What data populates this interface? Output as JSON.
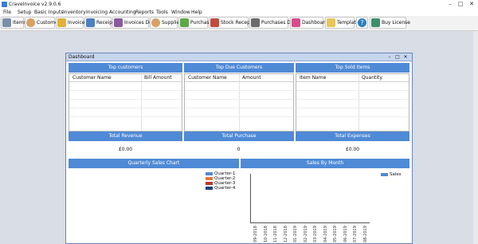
{
  "window": {
    "title": "CraveInvoice v2.9.0.6"
  },
  "menu": [
    "File",
    "Setup",
    "Basic Inputs",
    "Inventory",
    "Invoicing",
    "Accounting",
    "Reports",
    "Tools",
    "Window",
    "Help"
  ],
  "toolbar": {
    "items": [
      {
        "label": "Items",
        "icon": "items-icon",
        "color": "#7a8fa8"
      },
      {
        "label": "Customer",
        "icon": "customer-icon",
        "color": "#d9a066"
      },
      {
        "label": "Invoices",
        "icon": "invoices-icon",
        "color": "#e0b23a"
      },
      {
        "label": "Receipt",
        "icon": "receipt-icon",
        "color": "#4d7fc4"
      },
      {
        "label": "Invoices Due",
        "icon": "invoices-due-icon",
        "color": "#8a5a9e"
      },
      {
        "label": "Supplier",
        "icon": "supplier-icon",
        "color": "#d9a066"
      },
      {
        "label": "Purchases",
        "icon": "purchases-icon",
        "color": "#5da84a"
      },
      {
        "label": "Stock Recepts",
        "icon": "stock-receipts-icon",
        "color": "#c04b3d"
      },
      {
        "label": "Purchases Due",
        "icon": "purchases-due-icon",
        "color": "#6b6b6b"
      },
      {
        "label": "Dashboard",
        "icon": "dashboard-icon",
        "color": "#d94a8c"
      },
      {
        "label": "Template",
        "icon": "template-icon",
        "color": "#e6c75a"
      },
      {
        "label": "",
        "icon": "help-icon",
        "color": "#2a7fbf"
      },
      {
        "label": "Buy License",
        "icon": "buy-license-icon",
        "color": "#3a8f6a"
      }
    ]
  },
  "dashboard": {
    "title": "Dashboard",
    "top_customers": {
      "title": "Top customers",
      "columns": [
        "Customer Name",
        "Bill Amount"
      ]
    },
    "top_due_customers": {
      "title": "Top Due Customers",
      "columns": [
        "Customer Name",
        "Amount"
      ]
    },
    "top_sold_items": {
      "title": "Top Sold Items",
      "columns": [
        "Item Name",
        "Quantity"
      ]
    },
    "total_revenue": {
      "title": "Total Revenue",
      "value": "£0.00"
    },
    "total_purchase": {
      "title": "Total Purchase",
      "value": "0"
    },
    "total_expenses": {
      "title": "Total Expenses",
      "value": "£0.00"
    },
    "quarterly_chart": {
      "title": "Quarterly Sales Chart",
      "legend": [
        {
          "name": "Quarter-1",
          "color": "#4f8ad6"
        },
        {
          "name": "Quarter-2",
          "color": "#e07b39"
        },
        {
          "name": "Quarter-3",
          "color": "#c0392b"
        },
        {
          "name": "Quarter-4",
          "color": "#1f3f7a"
        }
      ]
    },
    "sales_by_month": {
      "title": "Sales By Month",
      "legend": "Sales",
      "legend_color": "#4f8ad6",
      "months": [
        "09-2018",
        "10-2018",
        "11-2018",
        "12-2018",
        "01-2019",
        "02-2019",
        "03-2019",
        "04-2019",
        "05-2019",
        "06-2019",
        "07-2019",
        "08-2019"
      ]
    }
  }
}
